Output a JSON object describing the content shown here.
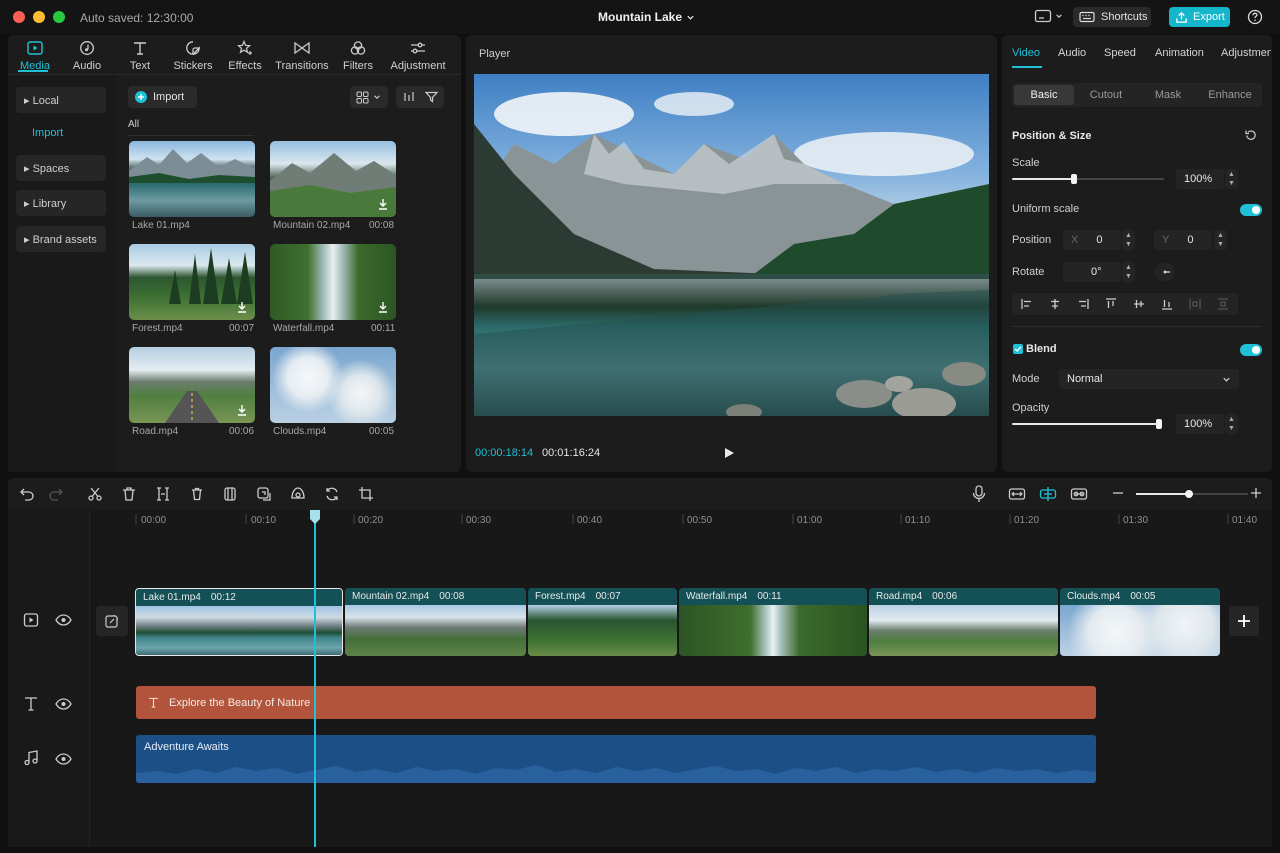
{
  "titlebar": {
    "autosave": "Auto saved:  12:30:00",
    "project_title": "Mountain Lake",
    "shortcuts_label": "Shortcuts",
    "export_label": "Export"
  },
  "media_tabs": [
    {
      "label": "Media",
      "icon": "media-icon",
      "active": true
    },
    {
      "label": "Audio",
      "icon": "audio-icon"
    },
    {
      "label": "Text",
      "icon": "text-icon"
    },
    {
      "label": "Stickers",
      "icon": "stickers-icon"
    },
    {
      "label": "Effects",
      "icon": "effects-icon"
    },
    {
      "label": "Transitions",
      "icon": "transitions-icon"
    },
    {
      "label": "Filters",
      "icon": "filters-icon"
    },
    {
      "label": "Adjustment",
      "icon": "adjustment-icon"
    }
  ],
  "sidebar": {
    "local": "Local",
    "import": "Import",
    "spaces": "Spaces",
    "library": "Library",
    "brand": "Brand assets"
  },
  "media": {
    "import_label": "Import",
    "filter_all": "All",
    "items": [
      {
        "name": "Lake 01.mp4",
        "duration": ""
      },
      {
        "name": "Mountain 02.mp4",
        "duration": "00:08"
      },
      {
        "name": "Forest.mp4",
        "duration": "00:07"
      },
      {
        "name": "Waterfall.mp4",
        "duration": "00:11"
      },
      {
        "name": "Road.mp4",
        "duration": "00:06"
      },
      {
        "name": "Clouds.mp4",
        "duration": "00:05"
      }
    ]
  },
  "player": {
    "title": "Player",
    "current_time": "00:00:18:14",
    "total_time": "00:01:16:24"
  },
  "inspector": {
    "tabs": [
      "Video",
      "Audio",
      "Speed",
      "Animation",
      "Adjustmen"
    ],
    "subtabs": [
      "Basic",
      "Cutout",
      "Mask",
      "Enhance"
    ],
    "position_size_title": "Position & Size",
    "scale_label": "Scale",
    "scale_value": "100%",
    "scale_fraction": 0.41,
    "uniform_scale_label": "Uniform scale",
    "position_label": "Position",
    "pos_x_label": "X",
    "pos_x": "0",
    "pos_y_label": "Y",
    "pos_y": "0",
    "rotate_label": "Rotate",
    "rotate_value": "0°",
    "blend_label": "Blend",
    "mode_label": "Mode",
    "mode_value": "Normal",
    "opacity_label": "Opacity",
    "opacity_value": "100%",
    "opacity_fraction": 1.0,
    "accent": "#1fc1d7"
  },
  "timeline": {
    "ruler": [
      "00:00",
      "00:10",
      "00:20",
      "00:30",
      "00:40",
      "00:50",
      "01:00",
      "01:10",
      "01:20",
      "01:30",
      "01:40"
    ],
    "clips": [
      {
        "name": "Lake 01.mp4",
        "duration": "00:12"
      },
      {
        "name": "Mountain 02.mp4",
        "duration": "00:08"
      },
      {
        "name": "Forest.mp4",
        "duration": "00:07"
      },
      {
        "name": "Waterfall.mp4",
        "duration": "00:11"
      },
      {
        "name": "Road.mp4",
        "duration": "00:06"
      },
      {
        "name": "Clouds.mp4",
        "duration": "00:05"
      }
    ],
    "text_clip": "Explore the Beauty of Nature",
    "audio_clip": "Adventure Awaits",
    "zoom_fraction": 0.47,
    "text_clip_color": "#b2533b",
    "audio_clip_color": "#1d4f87"
  }
}
